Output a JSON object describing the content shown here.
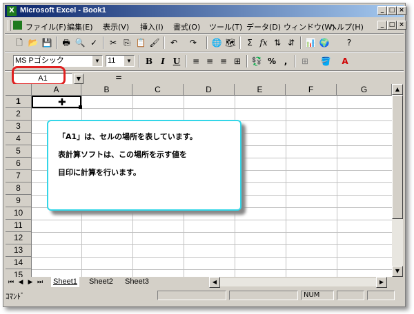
{
  "title_bar": {
    "title": "Microsoft Excel - Book1"
  },
  "menu": [
    "ファイル(F)",
    "編集(E)",
    "表示(V)",
    "挿入(I)",
    "書式(O)",
    "ツール(T)",
    "データ(D)",
    "ウィンドウ(W)",
    "ヘルプ(H)"
  ],
  "toolbar": {
    "font_name": "MS Pゴシック",
    "font_size": "11",
    "bold": "B",
    "italic": "I",
    "underline": "U",
    "percent": "%",
    "comma": ",",
    "sum": "Σ",
    "fx": "fx",
    "font_color_label": "A"
  },
  "formula_bar": {
    "name_box": "A1",
    "equals": "="
  },
  "columns": [
    "A",
    "B",
    "C",
    "D",
    "E",
    "F",
    "G"
  ],
  "rows": [
    "1",
    "2",
    "3",
    "4",
    "5",
    "6",
    "7",
    "8",
    "9",
    "10",
    "11",
    "12",
    "13",
    "14",
    "15"
  ],
  "callout": {
    "line1": "「A1」は、セルの場所を表しています。",
    "line2": "表計算ソフトは、この場所を示す値を",
    "line3": "目印に計算を行います。",
    "border_color": "#33d6e8"
  },
  "highlight_color": "#e02020",
  "sheets": [
    "Sheet1",
    "Sheet2",
    "Sheet3"
  ],
  "status": {
    "mode": "ｺﾏﾝﾄﾞ",
    "num": "NUM"
  },
  "colors": {
    "title_start": "#0a246a",
    "title_end": "#a6caf0",
    "chrome": "#d4d0c8"
  }
}
